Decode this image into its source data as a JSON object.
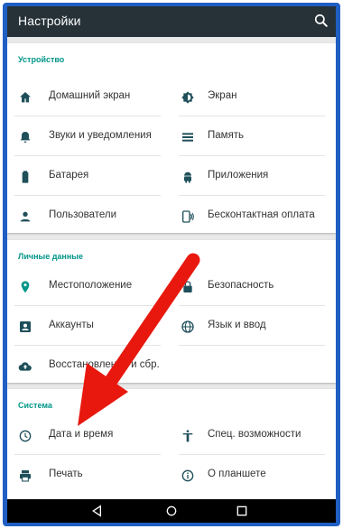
{
  "toolbar": {
    "title": "Настройки",
    "search_icon": "search-icon"
  },
  "colors": {
    "accent": "#009688",
    "toolbar": "#263238",
    "frame": "#1f5fc4",
    "arrow": "#e8180f"
  },
  "sections": [
    {
      "title": "Устройство",
      "items": [
        {
          "label": "Домашний экран",
          "icon": "home-icon"
        },
        {
          "label": "Экран",
          "icon": "brightness-icon"
        },
        {
          "label": "Звуки и уведомления",
          "icon": "bell-icon"
        },
        {
          "label": "Память",
          "icon": "storage-icon"
        },
        {
          "label": "Батарея",
          "icon": "battery-icon"
        },
        {
          "label": "Приложения",
          "icon": "android-icon"
        },
        {
          "label": "Пользователи",
          "icon": "person-icon"
        },
        {
          "label": "Бесконтактная оплата",
          "icon": "nfc-icon"
        }
      ]
    },
    {
      "title": "Личные данные",
      "items": [
        {
          "label": "Местоположение",
          "icon": "location-icon"
        },
        {
          "label": "Безопасность",
          "icon": "lock-icon"
        },
        {
          "label": "Аккаунты",
          "icon": "account-icon"
        },
        {
          "label": "Язык и ввод",
          "icon": "globe-icon"
        },
        {
          "label": "Восстановление и сбр.",
          "icon": "backup-icon"
        }
      ]
    },
    {
      "title": "Система",
      "items": [
        {
          "label": "Дата и время",
          "icon": "clock-icon"
        },
        {
          "label": "Спец. возможности",
          "icon": "accessibility-icon"
        },
        {
          "label": "Печать",
          "icon": "print-icon"
        },
        {
          "label": "О планшете",
          "icon": "info-icon"
        }
      ]
    }
  ],
  "navbar": {
    "back": "back-icon",
    "home": "home-circle-icon",
    "recents": "recents-icon"
  }
}
